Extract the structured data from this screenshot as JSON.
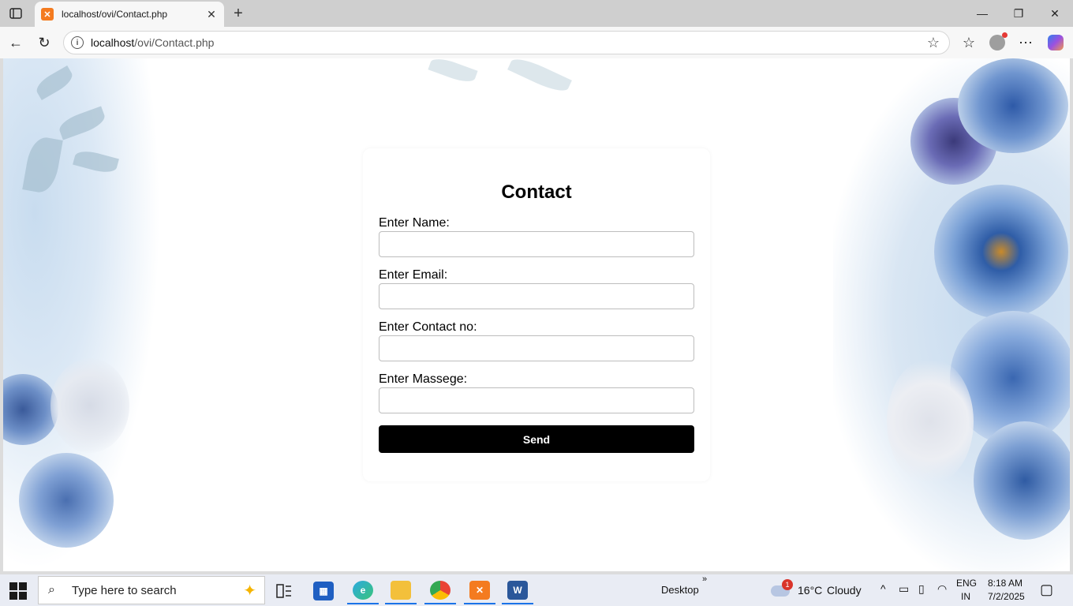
{
  "browser": {
    "tab_title": "localhost/ovi/Contact.php",
    "url_host": "localhost",
    "url_path": "/ovi/Contact.php"
  },
  "form": {
    "title": "Contact",
    "fields": [
      {
        "label": "Enter Name:",
        "value": ""
      },
      {
        "label": "Enter Email:",
        "value": ""
      },
      {
        "label": "Enter Contact no:",
        "value": ""
      },
      {
        "label": "Enter Massege:",
        "value": ""
      }
    ],
    "submit_label": "Send"
  },
  "taskbar": {
    "search_placeholder": "Type here to search",
    "desktop_label": "Desktop",
    "weather_temp": "16°C",
    "weather_cond": "Cloudy",
    "weather_badge": "1",
    "lang_1": "ENG",
    "lang_2": "IN",
    "time": "8:18 AM",
    "date": "7/2/2025"
  },
  "colors": {
    "accent": "#1a73e8",
    "button_bg": "#000000",
    "xampp": "#f47b20"
  }
}
